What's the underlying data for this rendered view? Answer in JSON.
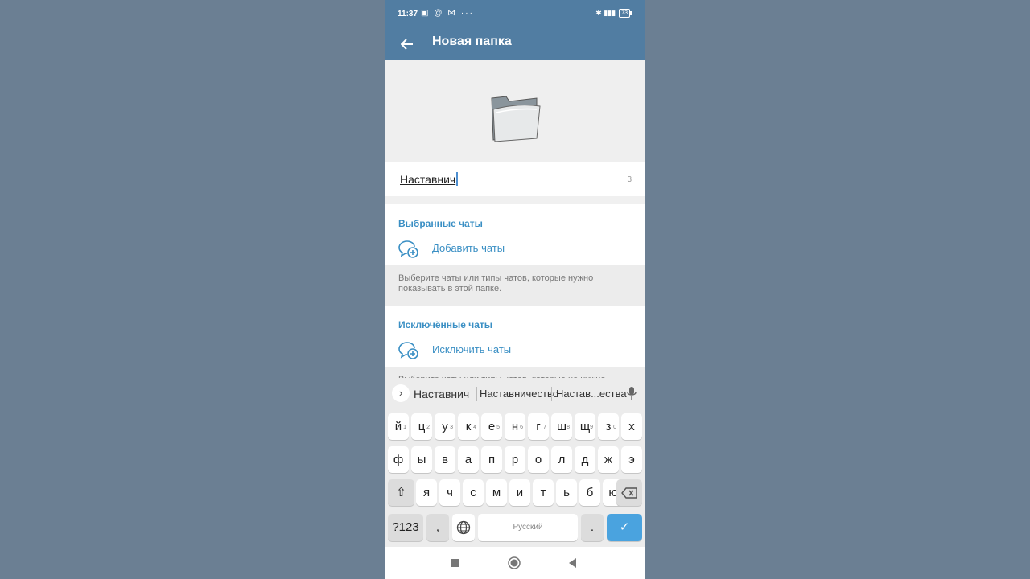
{
  "status_bar": {
    "time": "11:37",
    "left_icons": "▣ @ ⋈ ···",
    "right_icons": "✱ ▮▮▮",
    "battery": "73"
  },
  "app_bar": {
    "title": "Новая папка"
  },
  "folder": {
    "name_value": "Наставнич",
    "char_count": "3"
  },
  "included": {
    "title": "Выбранные чаты",
    "add_label": "Добавить чаты",
    "hint": "Выберите чаты или типы чатов, которые нужно показывать в этой папке."
  },
  "excluded": {
    "title": "Исключённые чаты",
    "add_label": "Исключить чаты",
    "hint": "Выберите чаты или типы чатов, которые не нужно"
  },
  "keyboard": {
    "suggestions": [
      "Наставнич",
      "Наставничество",
      "Настав...ества"
    ],
    "row1": [
      {
        "k": "й",
        "n": "1"
      },
      {
        "k": "ц",
        "n": "2"
      },
      {
        "k": "у",
        "n": "3"
      },
      {
        "k": "к",
        "n": "4"
      },
      {
        "k": "е",
        "n": "5"
      },
      {
        "k": "н",
        "n": "6"
      },
      {
        "k": "г",
        "n": "7"
      },
      {
        "k": "ш",
        "n": "8"
      },
      {
        "k": "щ",
        "n": "9"
      },
      {
        "k": "з",
        "n": "0"
      },
      {
        "k": "х",
        "n": ""
      }
    ],
    "row2": [
      "ф",
      "ы",
      "в",
      "а",
      "п",
      "р",
      "о",
      "л",
      "д",
      "ж",
      "э"
    ],
    "row3": [
      "я",
      "ч",
      "с",
      "м",
      "и",
      "т",
      "ь",
      "б",
      "ю"
    ],
    "shift": "⇧",
    "numbers_label": "?123",
    "emoji_comma": ",",
    "space_label": "Русский",
    "period": ".",
    "enter": "✓"
  }
}
